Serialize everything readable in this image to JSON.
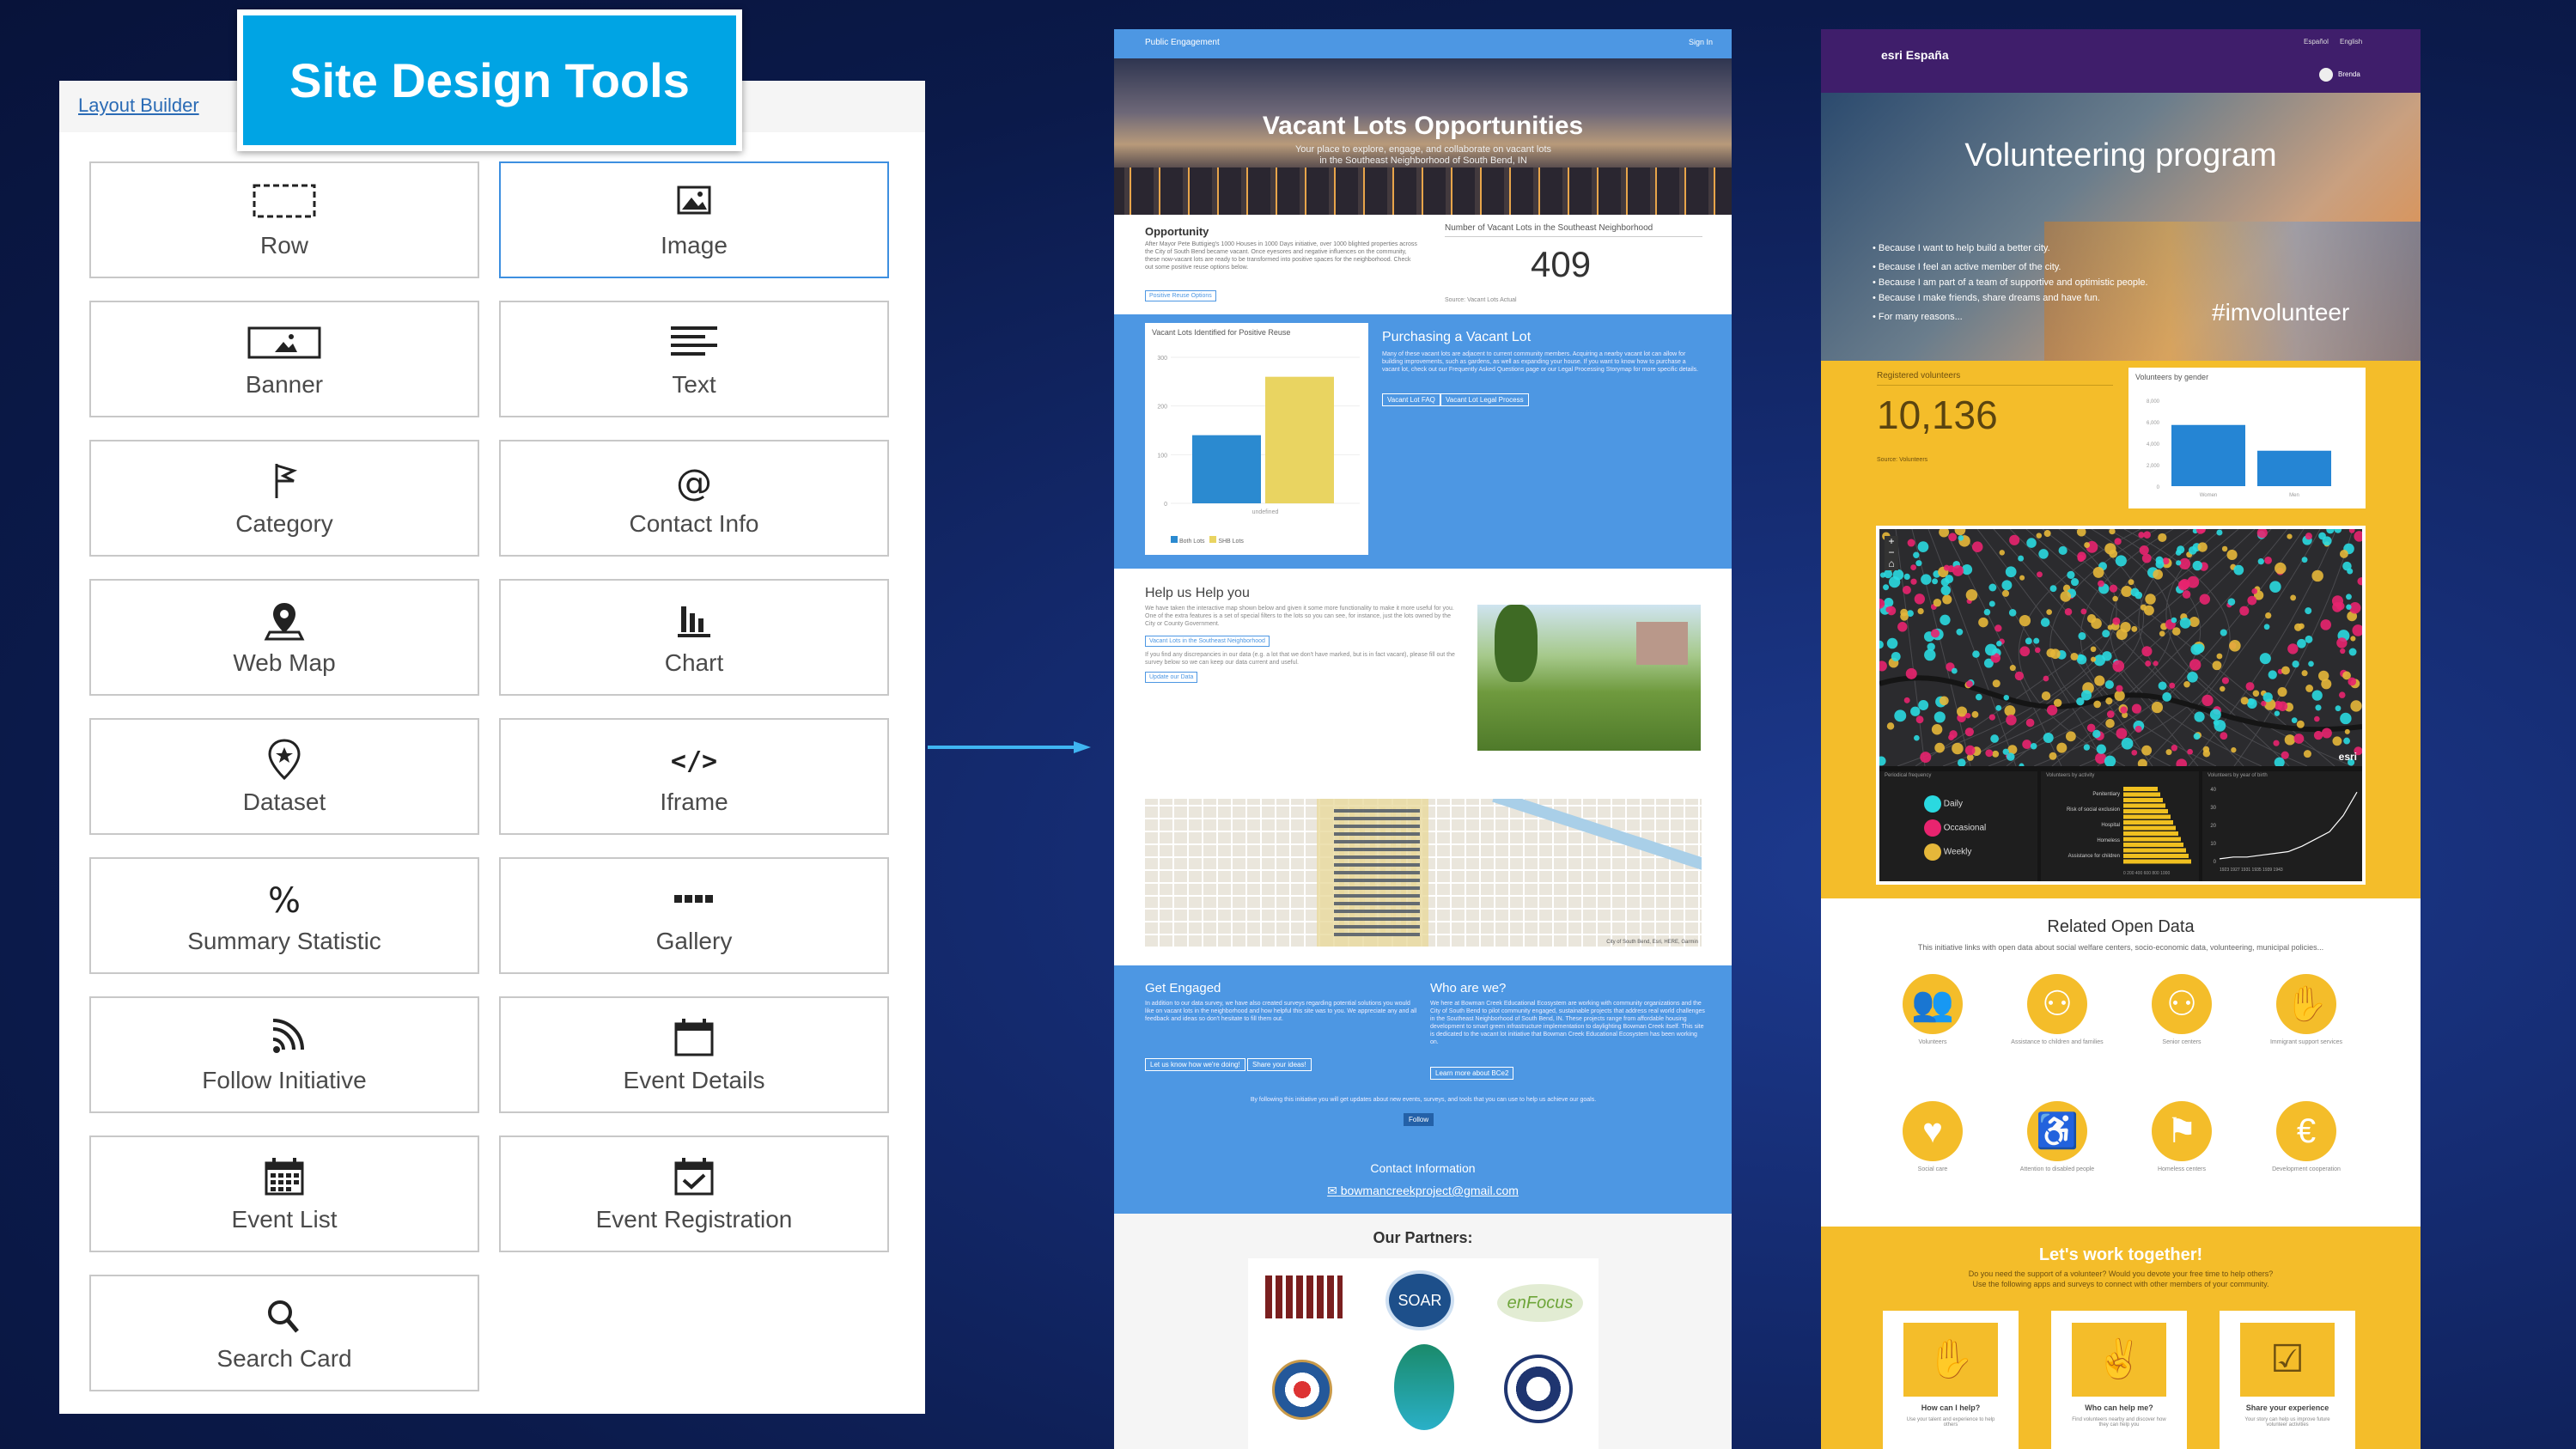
{
  "layout_builder": {
    "link": "Layout Builder",
    "badge": "Site Design Tools",
    "tiles": [
      {
        "label": "Row",
        "icon": "row-icon"
      },
      {
        "label": "Image",
        "icon": "image-icon"
      },
      {
        "label": "Banner",
        "icon": "banner-icon"
      },
      {
        "label": "Text",
        "icon": "text-icon"
      },
      {
        "label": "Category",
        "icon": "flag-icon"
      },
      {
        "label": "Contact Info",
        "icon": "at-icon"
      },
      {
        "label": "Web Map",
        "icon": "map-pin-icon"
      },
      {
        "label": "Chart",
        "icon": "bar-chart-icon"
      },
      {
        "label": "Dataset",
        "icon": "dataset-pin-icon"
      },
      {
        "label": "Iframe",
        "icon": "code-icon"
      },
      {
        "label": "Summary Statistic",
        "icon": "percent-icon"
      },
      {
        "label": "Gallery",
        "icon": "gallery-icon"
      },
      {
        "label": "Follow Initiative",
        "icon": "rss-icon"
      },
      {
        "label": "Event Details",
        "icon": "calendar-icon"
      },
      {
        "label": "Event List",
        "icon": "calendar-grid-icon"
      },
      {
        "label": "Event Registration",
        "icon": "calendar-check-icon"
      },
      {
        "label": "Search Card",
        "icon": "search-icon"
      }
    ]
  },
  "site1": {
    "nav_left": "Public Engagement",
    "nav_right": "Sign In",
    "title": "Vacant Lots Opportunities",
    "subtitle": "Your place to explore, engage, and collaborate on vacant lots in the Southeast Neighborhood of South Bend, IN",
    "opportunity_title": "Opportunity",
    "opportunity_text": "After Mayor Pete Buttigieg's 1000 Houses in 1000 Days initiative, over 1000 blighted properties across the City of South Bend became vacant. Once eyesores and negative influences on the community, these now-vacant lots are ready to be transformed into positive spaces for the neighborhood. Check out some positive reuse options below.",
    "opportunity_btn": "Positive Reuse Options",
    "stat_label": "Number of Vacant Lots in the Southeast Neighborhood",
    "stat_value": "409",
    "stat_source": "Source: Vacant Lots Actual",
    "chart_title": "Vacant Lots Identified for Positive Reuse",
    "chart_xlabel": "undefined",
    "legend": [
      "Both Lots",
      "SHB Lots"
    ],
    "purchasing_title": "Purchasing a Vacant Lot",
    "purchasing_text": "Many of these vacant lots are adjacent to current community members. Acquiring a nearby vacant lot can allow for building improvements, such as gardens, as well as expanding your house. If you want to know how to purchase a vacant lot, check out our Frequently Asked Questions page or our Legal Processing Storymap for more specific details.",
    "purchasing_btns": [
      "Vacant Lot FAQ",
      "Vacant Lot Legal Process"
    ],
    "help_title": "Help us Help you",
    "help_text": "We have taken the interactive map shown below and given it some more functionality to make it more useful for you. One of the extra features is a set of special filters to the lots so you can see, for instance, just the lots owned by the City or County Government.",
    "help_btn1": "Vacant Lots in the Southeast Neighborhood",
    "help_text2": "If you find any discrepancies in our data (e.g. a lot that we don't have marked, but is in fact vacant), please fill out the survey below so we can keep our data current and useful.",
    "help_btn2": "Update our Data",
    "map_attribution": "City of South Bend, Esri, HERE, Garmin",
    "engaged_title": "Get Engaged",
    "engaged_text": "In addition to our data survey, we have also created surveys regarding potential solutions you would like on vacant lots in the neighborhood and how helpful this site was to you. We appreciate any and all feedback and ideas so don't hesitate to fill them out.",
    "engaged_btns": [
      "Let us know how we're doing!",
      "Share your ideas!"
    ],
    "who_title": "Who are we?",
    "who_text": "We here at Bowman Creek Educational Ecosystem are working with community organizations and the City of South Bend to pilot community engaged, sustainable projects that address real world challenges in the Southeast Neighborhood of South Bend, IN. These projects range from affordable housing development to smart green infrastructure implementation to daylighting Bowman Creek itself. This site is dedicated to the vacant lot initiative that Bowman Creek Educational Ecosystem has been working on.",
    "who_btn": "Learn more about BCe2",
    "follow_text": "By following this initiative you will get updates about new events, surveys, and tools that you can use to help us achieve our goals.",
    "follow_btn": "Follow",
    "contact_title": "Contact Information",
    "contact_email": "bowmancreekproject@gmail.com",
    "partners_title": "Our Partners:",
    "partner_focus": "enFocus"
  },
  "site2": {
    "brand": "esri España",
    "lang1": "Español",
    "lang2": "English",
    "user": "Brenda",
    "title": "Volunteering program",
    "bullets": [
      "Because I want to help build a better city.",
      "Because I feel an active member of the city.",
      "Because I am part of a team of supportive and optimistic people.",
      "Because I make friends, share dreams and have fun.",
      "For many reasons..."
    ],
    "hashtag": "#imvolunteer",
    "reg_label": "Registered volunteers",
    "reg_value": "10,136",
    "reg_source": "Source: Volunteers",
    "gender_title": "Volunteers by gender",
    "gender_ticks": [
      "8,000",
      "6,000",
      "4,000",
      "2,000",
      "0"
    ],
    "gender_cats": [
      "Women",
      "Men"
    ],
    "map_attr": "esri",
    "freq_title": "Periodical frequency",
    "freq": [
      "Daily",
      "Occasional",
      "Weekly"
    ],
    "activity_title": "Volunteers by activity",
    "activities": [
      "Penitentiary",
      "Risk of social exclusion",
      "Hospital",
      "Homeless",
      "Assistance for children"
    ],
    "act_axis": "0  200 400 600 800 1000",
    "age_title": "Volunteers by year of birth",
    "age_ticks": [
      "40",
      "30",
      "20",
      "10",
      "0"
    ],
    "age_years": "1923  1927  1931  1935  1939  1943",
    "related_title": "Related Open Data",
    "related_text": "This initiative links with open data about social welfare centers, socio-economic data, volunteering, municipal policies...",
    "categories": [
      "Volunteers",
      "Assistance to children and families",
      "Senior centers",
      "Immigrant support services",
      "Social care",
      "Attention to disabled people",
      "Homeless centers",
      "Development cooperation"
    ],
    "work_title": "Let's work together!",
    "work_text1": "Do you need the support of a volunteer? Would you devote your free time to help others?",
    "work_text2": "Use the following apps and surveys to connect with other members of your community.",
    "cards": [
      {
        "title": "How can I help?",
        "text": "Use your talent and experience to help others"
      },
      {
        "title": "Who can help me?",
        "text": "Find volunteers nearby and discover how they can help you"
      },
      {
        "title": "Share your experience",
        "text": "Your story can help us improve future volunteer activities"
      }
    ]
  },
  "chart_data": [
    {
      "type": "bar",
      "title": "Vacant Lots Identified for Positive Reuse",
      "categories": [
        "undefined"
      ],
      "series": [
        {
          "name": "Both Lots",
          "values": [
            140
          ]
        },
        {
          "name": "SHB Lots",
          "values": [
            260
          ]
        }
      ],
      "ylim": [
        0,
        300
      ],
      "ticks": [
        0,
        100,
        200,
        300
      ]
    },
    {
      "type": "bar",
      "title": "Volunteers by gender",
      "categories": [
        "Women",
        "Men"
      ],
      "values": [
        5700,
        3300
      ],
      "ylim": [
        0,
        8000
      ]
    },
    {
      "type": "bar",
      "title": "Volunteers by activity",
      "categories": [
        "Assistance for children",
        "Homeless",
        "Hospital",
        "Risk of social exclusion",
        "Penitentiary"
      ],
      "values": [
        950,
        850,
        700,
        600,
        500
      ]
    },
    {
      "type": "line",
      "title": "Volunteers by year of birth",
      "x": [
        1923,
        1925,
        1927,
        1929,
        1931,
        1933,
        1935,
        1937,
        1939,
        1941,
        1943
      ],
      "y": [
        1,
        2,
        2,
        3,
        4,
        5,
        8,
        12,
        16,
        25,
        38
      ],
      "ylim": [
        0,
        40
      ]
    }
  ],
  "colors": {
    "lb_blue": "#00a4e4",
    "site1_blue": "#4d97e3",
    "site2_yellow": "#f4bd2a",
    "site2_purple": "#3f1e6b",
    "teal": "#2ad9e0",
    "magenta": "#e8246f"
  }
}
